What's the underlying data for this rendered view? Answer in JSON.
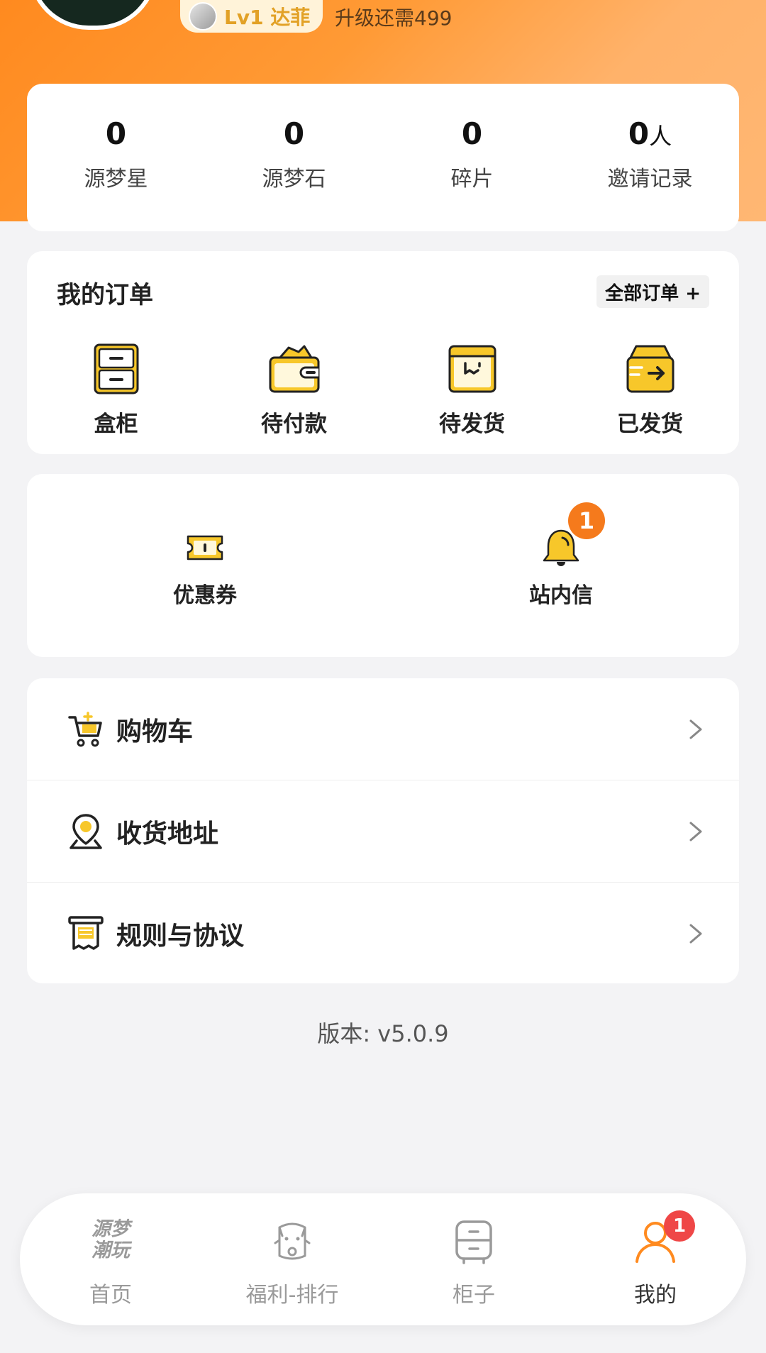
{
  "header": {
    "level_label": "Lv1 达菲",
    "upgrade_text": "升级还需499"
  },
  "stats": [
    {
      "value": "0",
      "unit": "",
      "label": "源梦星"
    },
    {
      "value": "0",
      "unit": "",
      "label": "源梦石"
    },
    {
      "value": "0",
      "unit": "",
      "label": "碎片"
    },
    {
      "value": "0",
      "unit": "人",
      "label": "邀请记录"
    }
  ],
  "orders": {
    "title": "我的订单",
    "all_orders": "全部订单 +",
    "items": [
      {
        "label": "盒柜",
        "icon": "cabinet-icon"
      },
      {
        "label": "待付款",
        "icon": "wallet-icon"
      },
      {
        "label": "待发货",
        "icon": "package-box-icon"
      },
      {
        "label": "已发货",
        "icon": "shipped-box-icon"
      }
    ]
  },
  "tools": [
    {
      "label": "优惠券",
      "icon": "coupon-icon",
      "badge": ""
    },
    {
      "label": "站内信",
      "icon": "bell-icon",
      "badge": "1"
    }
  ],
  "menu": [
    {
      "label": "购物车",
      "icon": "cart-icon"
    },
    {
      "label": "收货地址",
      "icon": "location-pin-icon"
    },
    {
      "label": "规则与协议",
      "icon": "document-icon"
    }
  ],
  "version": "版本: v5.0.9",
  "nav": {
    "brand_line1": "源梦",
    "brand_line2": "潮玩",
    "items": [
      {
        "label": "首页",
        "icon": "home-brand-logo-icon"
      },
      {
        "label": "福利-排行",
        "icon": "lucky-cat-icon"
      },
      {
        "label": "柜子",
        "icon": "cabinet-nav-icon"
      },
      {
        "label": "我的",
        "icon": "user-icon",
        "badge": "1"
      }
    ]
  },
  "colors": {
    "accent_orange": "#ff8a1f",
    "icon_yellow": "#f7c72a",
    "badge_orange": "#f57a1c",
    "badge_red": "#ef4747"
  }
}
